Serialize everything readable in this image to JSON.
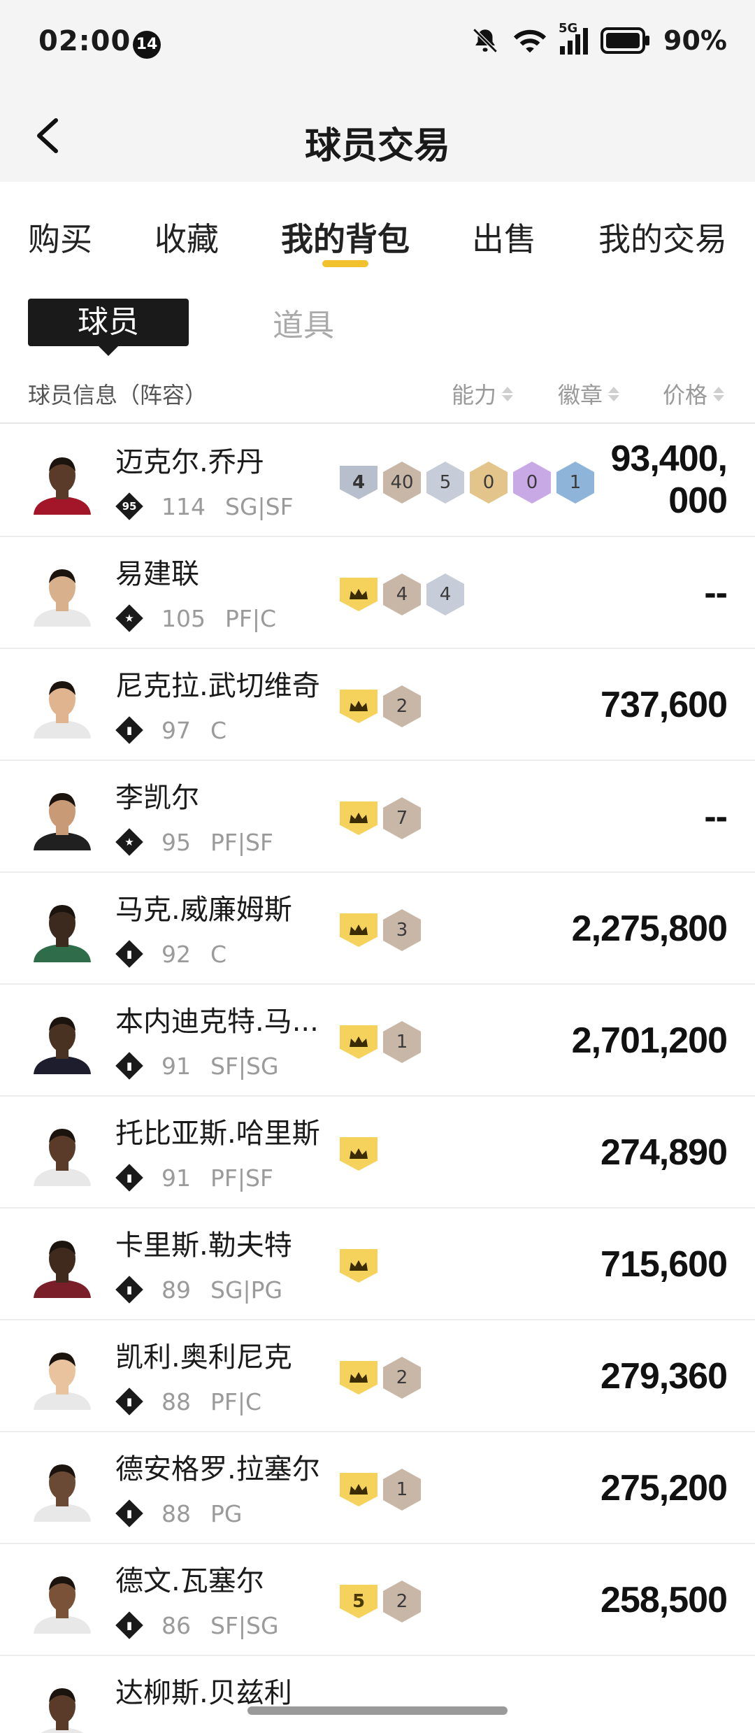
{
  "status": {
    "time": "02:00",
    "notif_count": "14",
    "network": "5G",
    "battery": "90%"
  },
  "nav": {
    "title": "球员交易"
  },
  "tabs": [
    "购买",
    "收藏",
    "我的背包",
    "出售",
    "我的交易"
  ],
  "subtabs": {
    "active": "球员",
    "other": "道具"
  },
  "header": {
    "info": "球员信息（阵容）",
    "ability": "能力",
    "badge": "徽章",
    "price": "价格"
  },
  "rows": [
    {
      "name": "迈克尔.乔丹",
      "icon": "95",
      "ovr": "114",
      "pos": "SG|SF",
      "price": "93,400,000",
      "badges": [
        {
          "t": "shield",
          "c": "gray",
          "v": "4"
        },
        {
          "t": "hex",
          "c": "#c8b7a6",
          "v": "40"
        },
        {
          "t": "hex",
          "c": "#c7cdd8",
          "v": "5"
        },
        {
          "t": "hex",
          "c": "#e3c48b",
          "v": "0"
        },
        {
          "t": "hex",
          "c": "#c9a8e6",
          "v": "0"
        },
        {
          "t": "hex",
          "c": "#8fb4da",
          "v": "1"
        }
      ]
    },
    {
      "name": "易建联",
      "icon": "star",
      "ovr": "105",
      "pos": "PF|C",
      "price": "--",
      "badges": [
        {
          "t": "shield",
          "c": "gold",
          "v": "crown"
        },
        {
          "t": "hex",
          "c": "#c8b7a6",
          "v": "4"
        },
        {
          "t": "hex",
          "c": "#c7cdd8",
          "v": "4"
        }
      ]
    },
    {
      "name": "尼克拉.武切维奇",
      "icon": "bars",
      "ovr": "97",
      "pos": "C",
      "price": "737,600",
      "badges": [
        {
          "t": "shield",
          "c": "gold",
          "v": "crown"
        },
        {
          "t": "hex",
          "c": "#c8b7a6",
          "v": "2"
        }
      ]
    },
    {
      "name": "李凯尔",
      "icon": "star",
      "ovr": "95",
      "pos": "PF|SF",
      "price": "--",
      "badges": [
        {
          "t": "shield",
          "c": "gold",
          "v": "crown"
        },
        {
          "t": "hex",
          "c": "#c8b7a6",
          "v": "7"
        }
      ]
    },
    {
      "name": "马克.威廉姆斯",
      "icon": "bars",
      "ovr": "92",
      "pos": "C",
      "price": "2,275,800",
      "badges": [
        {
          "t": "shield",
          "c": "gold",
          "v": "crown"
        },
        {
          "t": "hex",
          "c": "#c8b7a6",
          "v": "3"
        }
      ]
    },
    {
      "name": "本内迪克特.马...",
      "icon": "bars",
      "ovr": "91",
      "pos": "SF|SG",
      "price": "2,701,200",
      "badges": [
        {
          "t": "shield",
          "c": "gold",
          "v": "crown"
        },
        {
          "t": "hex",
          "c": "#c8b7a6",
          "v": "1"
        }
      ]
    },
    {
      "name": "托比亚斯.哈里斯",
      "icon": "bars",
      "ovr": "91",
      "pos": "PF|SF",
      "price": "274,890",
      "badges": [
        {
          "t": "shield",
          "c": "gold",
          "v": "crown"
        }
      ]
    },
    {
      "name": "卡里斯.勒夫特",
      "icon": "bars",
      "ovr": "89",
      "pos": "SG|PG",
      "price": "715,600",
      "badges": [
        {
          "t": "shield",
          "c": "gold",
          "v": "crown"
        }
      ]
    },
    {
      "name": "凯利.奥利尼克",
      "icon": "bars",
      "ovr": "88",
      "pos": "PF|C",
      "price": "279,360",
      "badges": [
        {
          "t": "shield",
          "c": "gold",
          "v": "crown"
        },
        {
          "t": "hex",
          "c": "#c8b7a6",
          "v": "2"
        }
      ]
    },
    {
      "name": "德安格罗.拉塞尔",
      "icon": "bars",
      "ovr": "88",
      "pos": "PG",
      "price": "275,200",
      "badges": [
        {
          "t": "shield",
          "c": "gold",
          "v": "crown"
        },
        {
          "t": "hex",
          "c": "#c8b7a6",
          "v": "1"
        }
      ]
    },
    {
      "name": "德文.瓦塞尔",
      "icon": "bars",
      "ovr": "86",
      "pos": "SF|SG",
      "price": "258,500",
      "badges": [
        {
          "t": "shield",
          "c": "gold",
          "v": "5"
        },
        {
          "t": "hex",
          "c": "#c8b7a6",
          "v": "2"
        }
      ]
    },
    {
      "name": "达柳斯.贝兹利",
      "icon": "bars",
      "ovr": "",
      "pos": "",
      "price": "",
      "badges": []
    }
  ]
}
